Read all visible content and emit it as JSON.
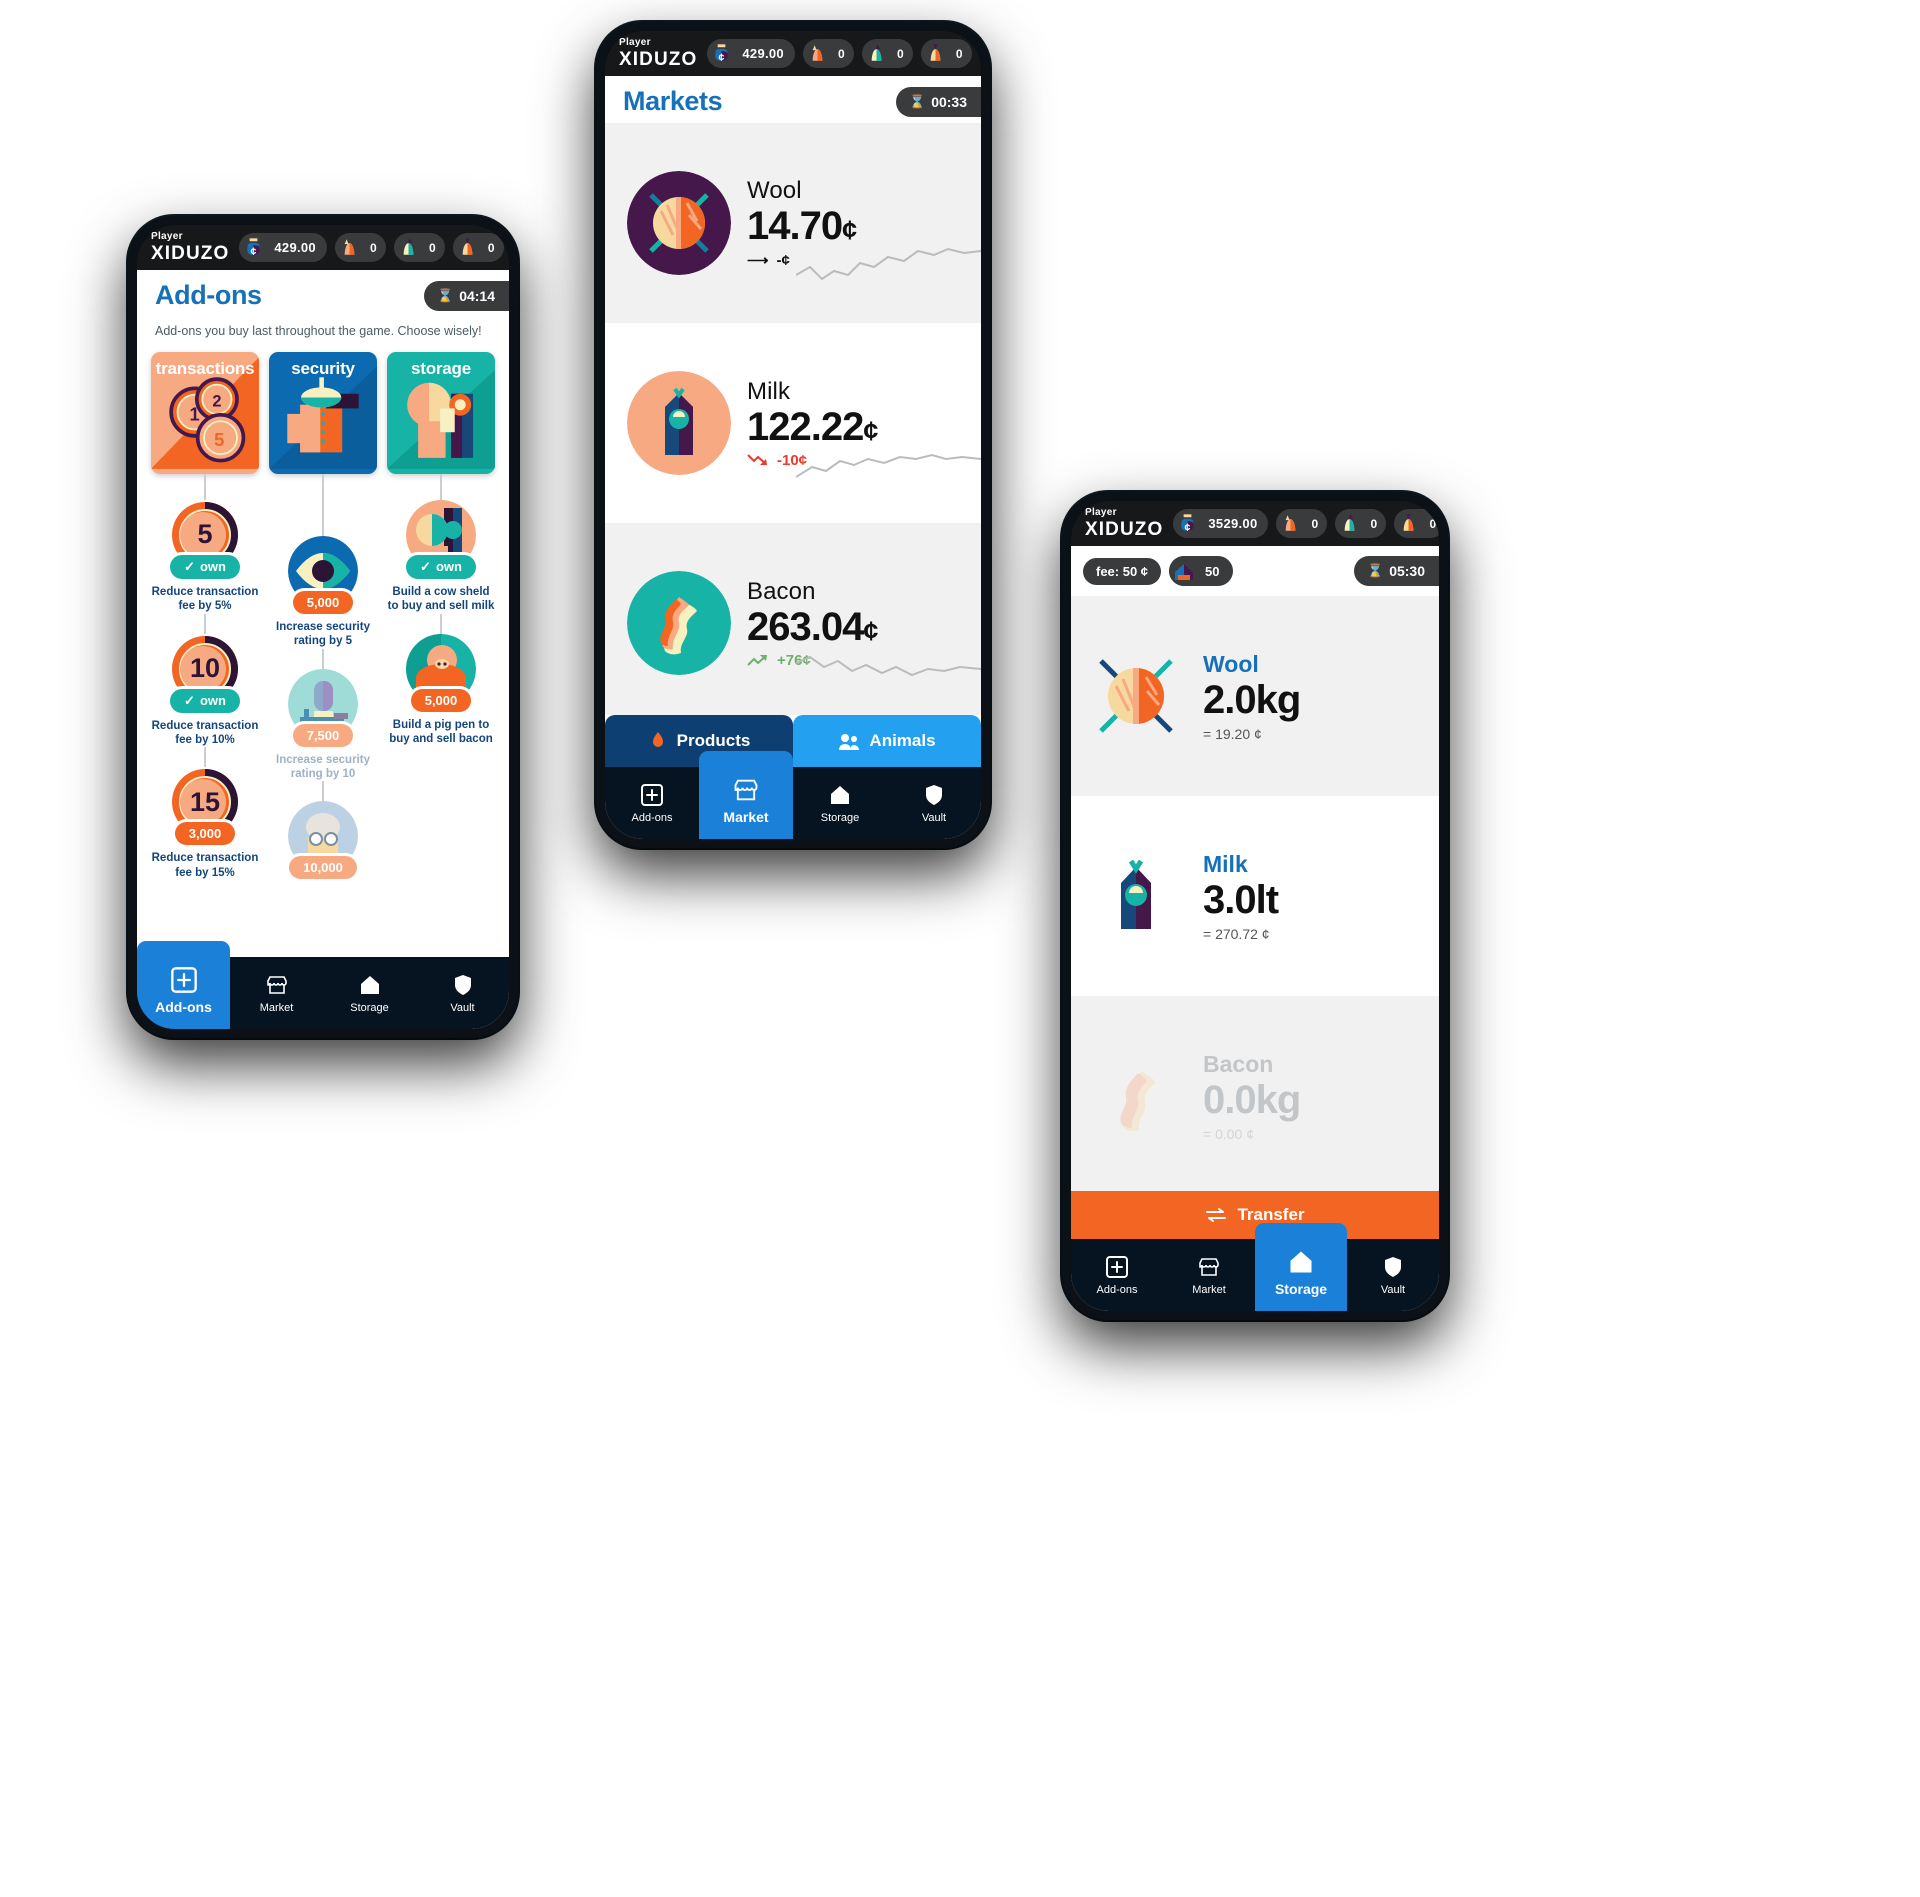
{
  "player": {
    "label": "Player",
    "name": "XIDUZO"
  },
  "phone_addons": {
    "wallet": "429.00",
    "counters": [
      {
        "icon": "pig-icon",
        "value": "0"
      },
      {
        "icon": "cow-icon",
        "value": "0"
      },
      {
        "icon": "sheep-icon",
        "value": "0"
      }
    ],
    "title": "Add-ons",
    "timer": "04:14",
    "description": "Add-ons you buy last throughout the game. Choose wisely!",
    "categories": [
      {
        "name": "transactions",
        "color": "#f26522"
      },
      {
        "name": "security",
        "color": "#0c6bb0"
      },
      {
        "name": "storage",
        "color": "#16b3a6"
      }
    ],
    "tracks": [
      {
        "key": "transactions",
        "nodes": [
          {
            "num": "5",
            "badge": "own",
            "badge_type": "own",
            "desc": "Reduce transaction fee by 5%",
            "dim": false
          },
          {
            "num": "10",
            "badge": "own",
            "badge_type": "own",
            "desc": "Reduce transaction fee by 10%",
            "dim": false
          },
          {
            "num": "15",
            "badge": "3,000",
            "badge_type": "cost",
            "desc": "Reduce transaction fee by 15%",
            "dim": false
          }
        ]
      },
      {
        "key": "security",
        "nodes": [
          {
            "icon": "eye-icon",
            "badge": "5,000",
            "badge_type": "cost",
            "desc": "Increase security rating by 5",
            "dim": false
          },
          {
            "icon": "guard-icon",
            "badge": "7,500",
            "badge_type": "cost-light",
            "desc": "Increase security rating by 10",
            "dim": true
          },
          {
            "icon": "scientist-icon",
            "badge": "10,000",
            "badge_type": "cost-light",
            "desc": "",
            "dim": true
          }
        ]
      },
      {
        "key": "storage",
        "nodes": [
          {
            "icon": "cow-shed-icon",
            "badge": "own",
            "badge_type": "own",
            "desc": "Build a cow sheld to buy and sell milk",
            "dim": false
          },
          {
            "icon": "pig-pen-icon",
            "badge": "5,000",
            "badge_type": "cost",
            "desc": "Build a pig pen to buy and sell bacon",
            "dim": false
          }
        ]
      }
    ],
    "nav": [
      {
        "label": "Add-ons",
        "icon": "addons-icon",
        "active": true
      },
      {
        "label": "Market",
        "icon": "market-icon",
        "active": false
      },
      {
        "label": "Storage",
        "icon": "storage-icon",
        "active": false
      },
      {
        "label": "Vault",
        "icon": "vault-icon",
        "active": false
      }
    ]
  },
  "phone_market": {
    "wallet": "429.00",
    "counters": [
      {
        "icon": "pig-icon",
        "value": "0"
      },
      {
        "icon": "cow-icon",
        "value": "0"
      },
      {
        "icon": "sheep-icon",
        "value": "0"
      }
    ],
    "title": "Markets",
    "timer": "00:33",
    "rows": [
      {
        "name": "Wool",
        "price": "14.70",
        "cent": "¢",
        "delta": "-¢",
        "trend": "flat",
        "icon": "wool-icon"
      },
      {
        "name": "Milk",
        "price": "122.22",
        "cent": "¢",
        "delta": "-10¢",
        "trend": "down",
        "icon": "milk-icon"
      },
      {
        "name": "Bacon",
        "price": "263.04",
        "cent": "¢",
        "delta": "+76¢",
        "trend": "up",
        "icon": "bacon-icon"
      }
    ],
    "tabs": [
      {
        "label": "Products",
        "icon": "products-icon",
        "active": true
      },
      {
        "label": "Animals",
        "icon": "animals-icon",
        "active": false
      }
    ],
    "nav": [
      {
        "label": "Add-ons",
        "icon": "addons-icon",
        "active": false
      },
      {
        "label": "Market",
        "icon": "market-icon",
        "active": true
      },
      {
        "label": "Storage",
        "icon": "storage-icon",
        "active": false
      },
      {
        "label": "Vault",
        "icon": "vault-icon",
        "active": false
      }
    ]
  },
  "phone_storage": {
    "wallet": "3529.00",
    "counters": [
      {
        "icon": "pig-icon",
        "value": "0"
      },
      {
        "icon": "cow-icon",
        "value": "0"
      },
      {
        "icon": "sheep-icon",
        "value": "0"
      }
    ],
    "fee_label": "fee: 50 ¢",
    "capacity": "50",
    "timer": "05:30",
    "rows": [
      {
        "name": "Wool",
        "qty": "2.0kg",
        "eq": "= 19.20 ¢",
        "icon": "wool-icon",
        "empty": false
      },
      {
        "name": "Milk",
        "qty": "3.0lt",
        "eq": "= 270.72 ¢",
        "icon": "milk-icon",
        "empty": false
      },
      {
        "name": "Bacon",
        "qty": "0.0kg",
        "eq": "= 0.00 ¢",
        "icon": "bacon-icon",
        "empty": true
      }
    ],
    "transfer_label": "Transfer",
    "nav": [
      {
        "label": "Add-ons",
        "icon": "addons-icon",
        "active": false
      },
      {
        "label": "Market",
        "icon": "market-icon",
        "active": false
      },
      {
        "label": "Storage",
        "icon": "storage-icon",
        "active": true
      },
      {
        "label": "Vault",
        "icon": "vault-icon",
        "active": false
      }
    ]
  },
  "colors": {
    "orange": "#f26522",
    "blue": "#1771b8",
    "teal": "#16b3a6",
    "purple": "#45174a",
    "navy": "#061320",
    "accent_blue": "#23a0f0",
    "up": "#6fae6b",
    "down": "#ec3a2b"
  }
}
